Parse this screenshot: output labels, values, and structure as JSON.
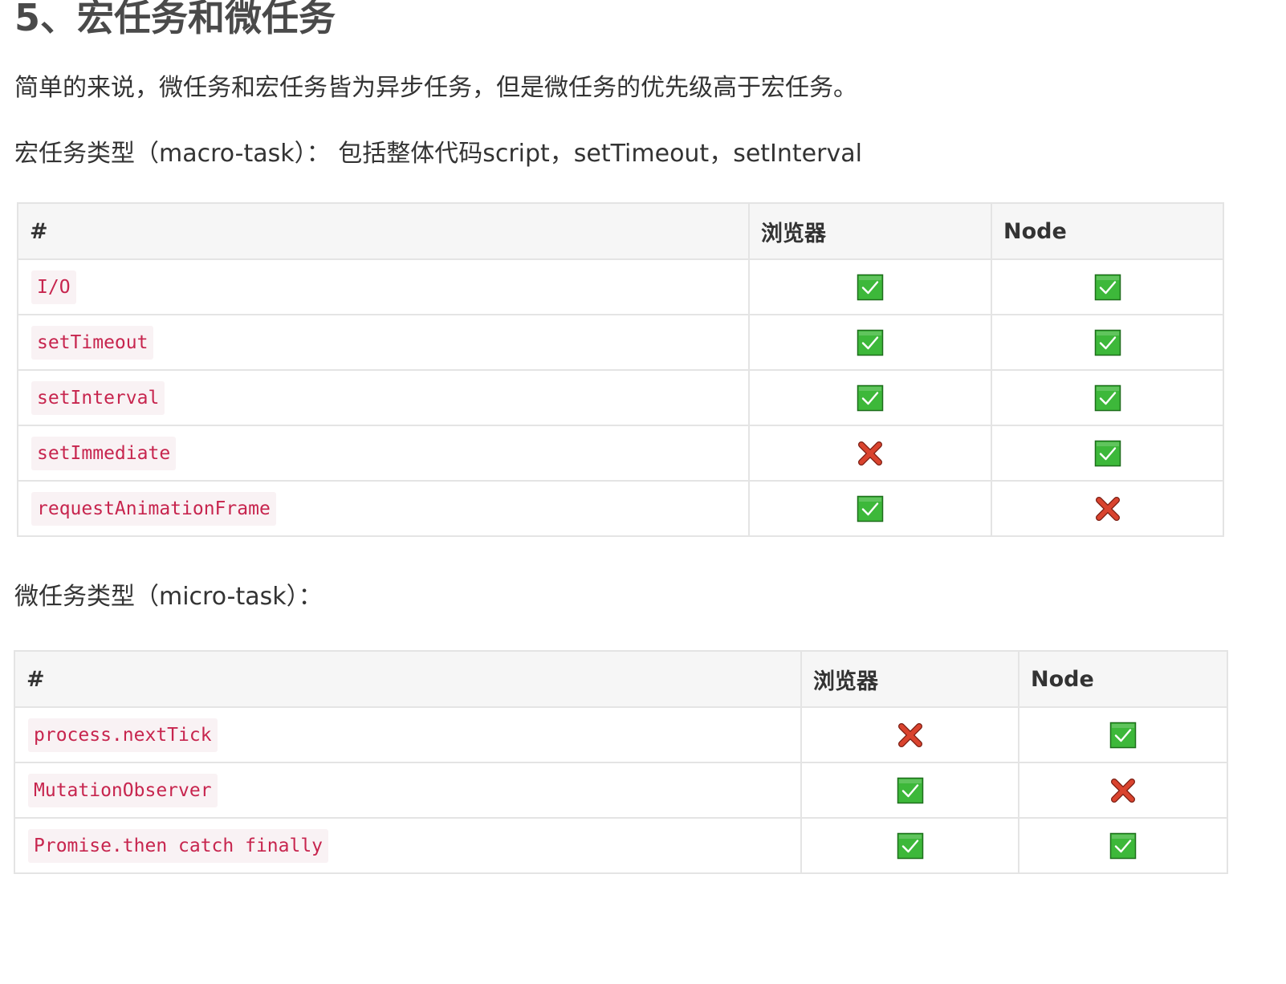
{
  "heading": "5、宏任务和微任务",
  "intro": "简单的来说，微任务和宏任务皆为异步任务，但是微任务的优先级高于宏任务。",
  "macro": {
    "heading": "宏任务类型（macro-task）： 包括整体代码script，setTimeout，setInterval",
    "columns": [
      "#",
      "浏览器",
      "Node"
    ],
    "rows": [
      {
        "name": "I/O",
        "browser": "check-icon",
        "node": "check-icon"
      },
      {
        "name": "setTimeout",
        "browser": "check-icon",
        "node": "check-icon"
      },
      {
        "name": "setInterval",
        "browser": "check-icon",
        "node": "check-icon"
      },
      {
        "name": "setImmediate",
        "browser": "cross-icon",
        "node": "check-icon"
      },
      {
        "name": "requestAnimationFrame",
        "browser": "check-icon",
        "node": "cross-icon"
      }
    ]
  },
  "micro": {
    "heading": "微任务类型（micro-task）：",
    "columns": [
      "#",
      "浏览器",
      "Node"
    ],
    "rows": [
      {
        "name": "process.nextTick",
        "browser": "cross-icon",
        "node": "check-icon"
      },
      {
        "name": "MutationObserver",
        "browser": "check-icon",
        "node": "cross-icon"
      },
      {
        "name": "Promise.then catch finally",
        "browser": "check-icon",
        "node": "check-icon"
      }
    ]
  },
  "colors": {
    "code_text": "#c7254e",
    "code_bg": "#f9f2f4",
    "check_fill": "#3db83a",
    "cross_fill": "#d9432e",
    "header_bg": "#f6f6f6",
    "border": "#e4e4e4"
  }
}
